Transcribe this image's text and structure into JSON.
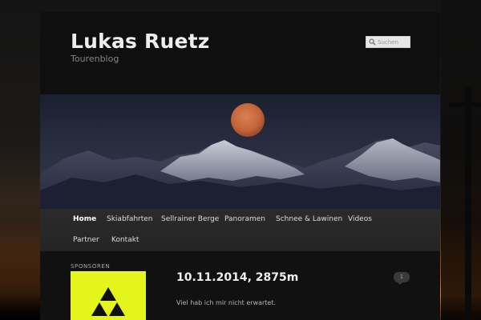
{
  "site": {
    "title": "Lukas Ruetz",
    "description": "Tourenblog"
  },
  "search": {
    "placeholder": "Suchen",
    "icon": "search-icon"
  },
  "nav": {
    "items": [
      {
        "label": "Home",
        "active": true
      },
      {
        "label": "Skiabfahrten"
      },
      {
        "label": "Sellrainer Berge"
      },
      {
        "label": "Panoramen"
      },
      {
        "label": "Schnee & Lawinen"
      },
      {
        "label": "Videos"
      },
      {
        "label": "Partner"
      },
      {
        "label": "Kontakt"
      }
    ]
  },
  "sidebar": {
    "sponsor_heading": "SPONSOREN",
    "sponsor_logo_color": "#e4f51d"
  },
  "post": {
    "title": "10.11.2014, 2875m",
    "comment_count": "1",
    "excerpt": "Viel hab ich mir nicht erwartet."
  },
  "colors": {
    "page_bg": "#0f0f0f",
    "nav_bg": "#2b2b2b",
    "moon": "#c56a3a"
  }
}
